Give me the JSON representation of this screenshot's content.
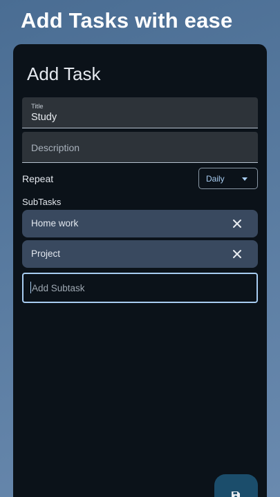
{
  "header": {
    "headline": "Add Tasks with ease"
  },
  "card": {
    "title": "Add Task"
  },
  "form": {
    "title_label": "Title",
    "title_value": "Study",
    "description_placeholder": "Description",
    "repeat_label": "Repeat",
    "repeat_value": "Daily",
    "subtasks_label": "SubTasks",
    "subtasks": [
      {
        "label": "Home work",
        "icon": "close-icon"
      },
      {
        "label": "Project",
        "icon": "close-icon"
      }
    ],
    "add_subtask_placeholder": "Add Subtask",
    "save_icon": "save-icon"
  },
  "colors": {
    "background": "#5a7ca1",
    "card": "#0b1219",
    "chip": "#39495f",
    "accent": "#a8cdf1",
    "fab": "#1b4d6b"
  }
}
